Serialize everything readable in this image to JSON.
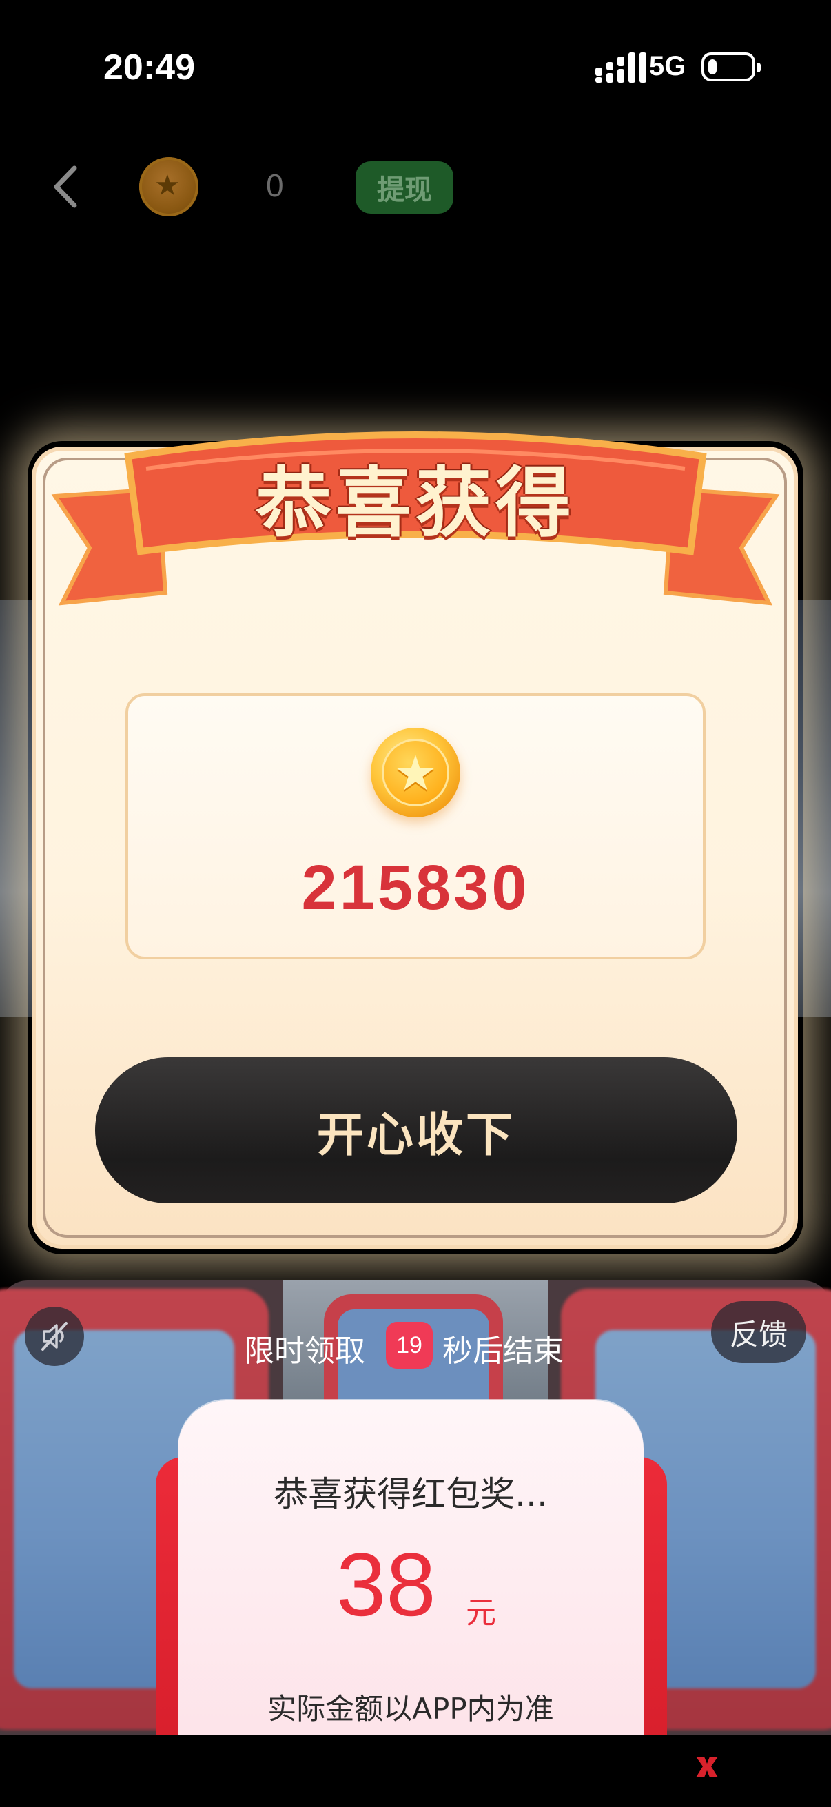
{
  "status_bar": {
    "time": "20:49",
    "network": "5G",
    "battery_level": 0.2
  },
  "header": {
    "coin_count": "0",
    "withdraw_label": "提现"
  },
  "modal": {
    "title": "恭喜获得",
    "reward_amount": "215830",
    "accept_label": "开心收下"
  },
  "ad": {
    "limited_prefix": "限时领取",
    "countdown": "19",
    "limited_suffix": "秒后结束",
    "feedback_label": "反馈",
    "card_title": "恭喜获得红包奖...",
    "card_amount": "38",
    "card_unit": "元",
    "card_note": "实际金额以APP内为准"
  },
  "colors": {
    "accent_red": "#d8333a",
    "ribbon": "#ef5b3c",
    "withdraw_green": "#1e5a28"
  }
}
